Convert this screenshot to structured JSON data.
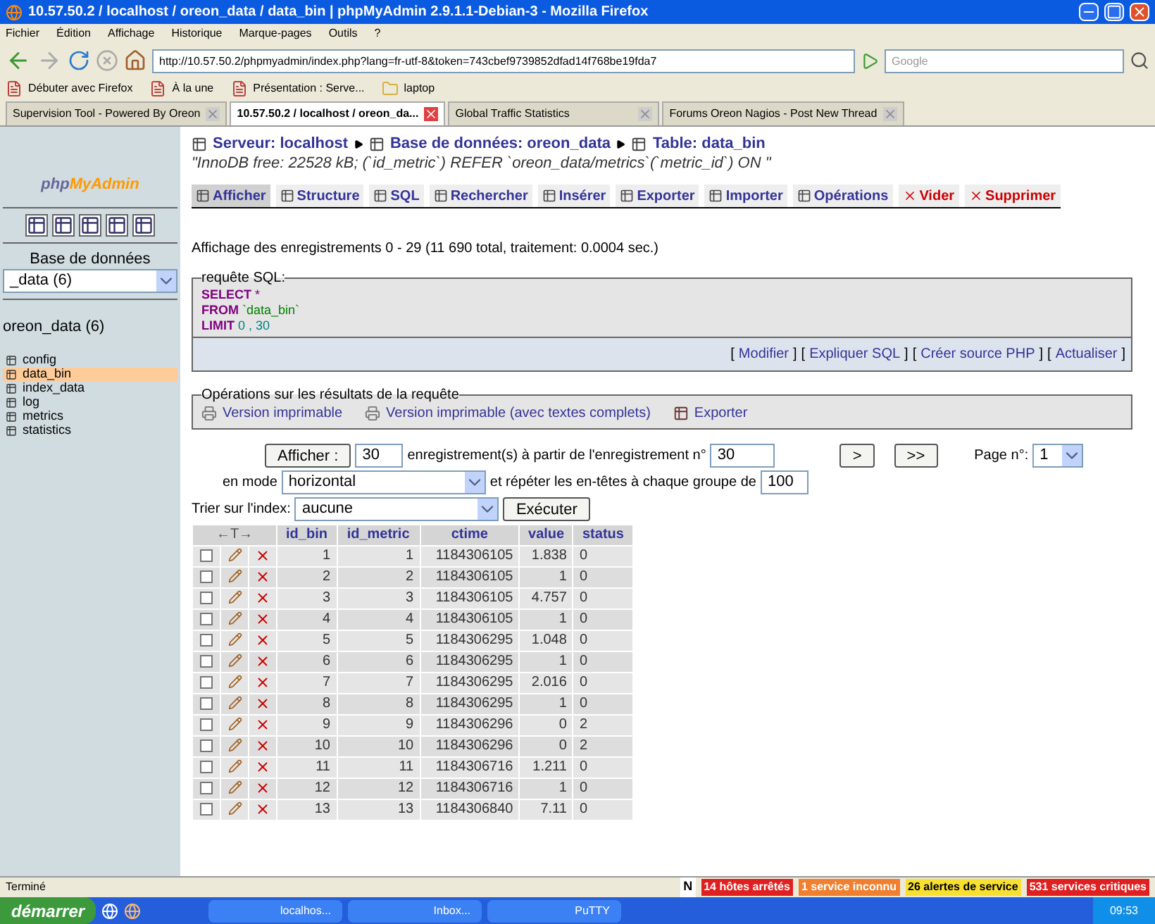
{
  "window": {
    "title": "10.57.50.2 / localhost / oreon_data / data_bin | phpMyAdmin 2.9.1.1-Debian-3 - Mozilla Firefox"
  },
  "menu": [
    "Fichier",
    "Édition",
    "Affichage",
    "Historique",
    "Marque-pages",
    "Outils",
    "?"
  ],
  "navbar": {
    "url": "http://10.57.50.2/phpmyadmin/index.php?lang=fr-utf-8&token=743cbef9739852dfad14f768be19fda7",
    "search_placeholder": "Google"
  },
  "bookmarks": [
    "Débuter avec Firefox",
    "À la une",
    "Présentation : Serve...",
    "laptop"
  ],
  "browser_tabs": [
    {
      "label": "Supervision Tool - Powered By Oreon",
      "selected": false
    },
    {
      "label": "10.57.50.2 / localhost / oreon_da...",
      "selected": true
    },
    {
      "label": "Global Traffic Statistics",
      "selected": false
    },
    {
      "label": "Forums Oreon Nagios - Post New Thread",
      "selected": false
    }
  ],
  "sidebar": {
    "logo": [
      "php",
      "MyAdmin"
    ],
    "db_label": "Base de données",
    "db_select": "_data (6)",
    "db_name": "oreon_data (6)",
    "tables": [
      {
        "name": "config",
        "selected": false
      },
      {
        "name": "data_bin",
        "selected": true
      },
      {
        "name": "index_data",
        "selected": false
      },
      {
        "name": "log",
        "selected": false
      },
      {
        "name": "metrics",
        "selected": false
      },
      {
        "name": "statistics",
        "selected": false
      }
    ]
  },
  "breadcrumb": [
    "Serveur: localhost",
    "Base de données: oreon_data",
    "Table: data_bin"
  ],
  "comment": "\"InnoDB free: 22528 kB; (`id_metric`) REFER `oreon_data/metrics`(`metric_id`) ON \"",
  "pma_tabs": [
    {
      "label": "Afficher",
      "selected": true,
      "kind": "normal"
    },
    {
      "label": "Structure",
      "selected": false,
      "kind": "normal"
    },
    {
      "label": "SQL",
      "selected": false,
      "kind": "normal"
    },
    {
      "label": "Rechercher",
      "selected": false,
      "kind": "normal"
    },
    {
      "label": "Insérer",
      "selected": false,
      "kind": "normal"
    },
    {
      "label": "Exporter",
      "selected": false,
      "kind": "normal"
    },
    {
      "label": "Importer",
      "selected": false,
      "kind": "normal"
    },
    {
      "label": "Opérations",
      "selected": false,
      "kind": "normal"
    },
    {
      "label": "Vider",
      "selected": false,
      "kind": "danger"
    },
    {
      "label": "Supprimer",
      "selected": false,
      "kind": "danger"
    }
  ],
  "summary": "Affichage des enregistrements 0 - 29 (11 690 total, traitement: 0.0004 sec.)",
  "sql": {
    "legend": "requête SQL:",
    "lines": [
      {
        "keyword": "SELECT",
        "rest": "*",
        "kind": "operator"
      },
      {
        "keyword": "FROM",
        "rest": "`data_bin`",
        "kind": "string"
      },
      {
        "keyword": "LIMIT",
        "rest": "0 , 30",
        "kind": "number"
      }
    ],
    "links": [
      "Modifier",
      "Expliquer SQL",
      "Créer source PHP",
      "Actualiser"
    ],
    "open": "[",
    "close": "]"
  },
  "operations": {
    "legend": "Opérations sur les résultats de la requête",
    "links": [
      "Version imprimable",
      "Version imprimable (avec textes complets)",
      "Exporter"
    ]
  },
  "navigation": {
    "show_button": "Afficher :",
    "count": "30",
    "count_label": "enregistrement(s) à partir de l'enregistrement n°",
    "start": "30",
    "next": ">",
    "last": ">>",
    "page_label": "Page n°:",
    "page": "1",
    "mode_label": "en mode",
    "mode": "horizontal",
    "repeat_label": "et répéter les en-têtes à chaque groupe de",
    "repeat": "100",
    "sort_label": "Trier sur l'index:",
    "sort": "aucune",
    "execute": "Exécuter"
  },
  "table": {
    "arrows": "←T→",
    "columns": [
      "id_bin",
      "id_metric",
      "ctime",
      "value",
      "status"
    ],
    "rows": [
      {
        "checked": false,
        "cells": [
          "1",
          "1",
          "1184306105",
          "1.838",
          "0"
        ]
      },
      {
        "checked": false,
        "cells": [
          "2",
          "2",
          "1184306105",
          "1",
          "0"
        ]
      },
      {
        "checked": false,
        "cells": [
          "3",
          "3",
          "1184306105",
          "4.757",
          "0"
        ]
      },
      {
        "checked": false,
        "cells": [
          "4",
          "4",
          "1184306105",
          "1",
          "0"
        ]
      },
      {
        "checked": false,
        "cells": [
          "5",
          "5",
          "1184306295",
          "1.048",
          "0"
        ]
      },
      {
        "checked": false,
        "cells": [
          "6",
          "6",
          "1184306295",
          "1",
          "0"
        ]
      },
      {
        "checked": false,
        "cells": [
          "7",
          "7",
          "1184306295",
          "2.016",
          "0"
        ]
      },
      {
        "checked": false,
        "cells": [
          "8",
          "8",
          "1184306295",
          "1",
          "0"
        ]
      },
      {
        "checked": false,
        "cells": [
          "9",
          "9",
          "1184306296",
          "0",
          "2"
        ]
      },
      {
        "checked": false,
        "cells": [
          "10",
          "10",
          "1184306296",
          "0",
          "2"
        ]
      },
      {
        "checked": false,
        "cells": [
          "11",
          "11",
          "1184306716",
          "1.211",
          "0"
        ]
      },
      {
        "checked": false,
        "cells": [
          "12",
          "12",
          "1184306716",
          "1",
          "0"
        ]
      },
      {
        "checked": false,
        "cells": [
          "13",
          "13",
          "1184306840",
          "7.11",
          "0"
        ]
      }
    ]
  },
  "status_bar": {
    "text": "Terminé",
    "badge": "N",
    "alerts": [
      {
        "label": "14 hôtes arrêtés",
        "color": "#e02020"
      },
      {
        "label": "1 service inconnu",
        "color": "#f08030"
      },
      {
        "label": "26 alertes de service",
        "color": "#f8e030"
      },
      {
        "label": "531 services critiques",
        "color": "#e02020"
      }
    ]
  },
  "taskbar": {
    "start": "démarrer",
    "items": [
      "localhos...",
      "Inbox...",
      "PuTTY"
    ],
    "clock": "09:53"
  }
}
